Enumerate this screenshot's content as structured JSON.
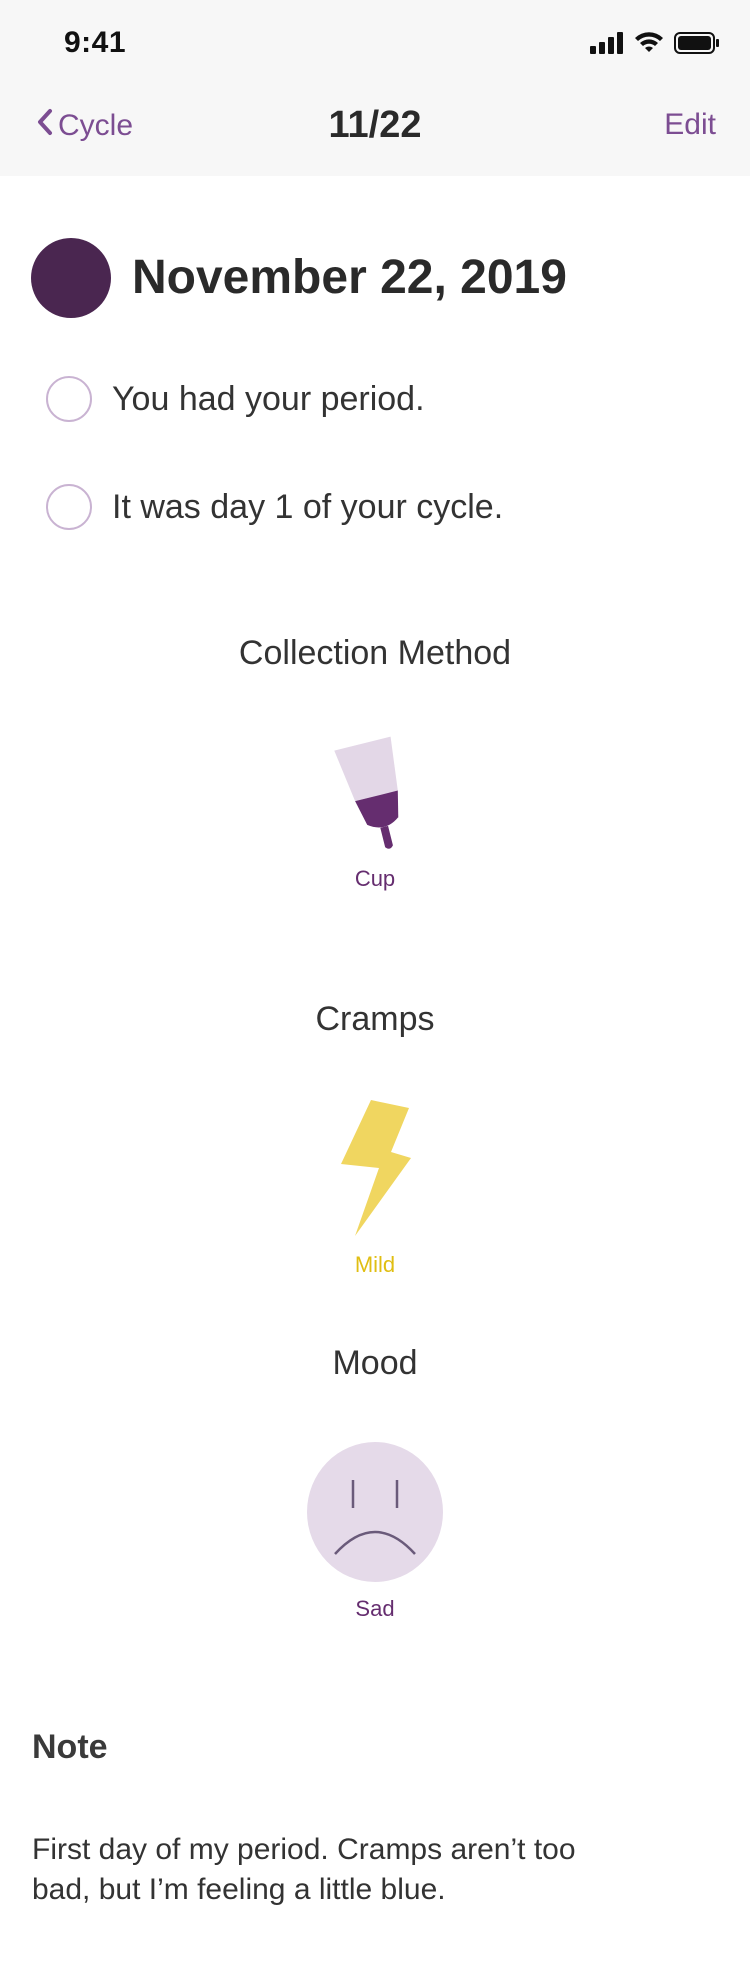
{
  "status_bar": {
    "time": "9:41",
    "icons": [
      "signal-icon",
      "wifi-icon",
      "battery-icon"
    ]
  },
  "nav": {
    "back_label": "Cycle",
    "title": "11/22",
    "edit_label": "Edit"
  },
  "day": {
    "date": "November 22, 2019",
    "statuses": [
      "You had your period.",
      "It was day 1 of your cycle."
    ]
  },
  "collection_method": {
    "heading": "Collection Method",
    "value": "Cup",
    "icon": "menstrual-cup-icon"
  },
  "cramps": {
    "heading": "Cramps",
    "value": "Mild",
    "icon": "lightning-icon"
  },
  "mood": {
    "heading": "Mood",
    "value": "Sad",
    "icon": "sad-face-icon"
  },
  "note": {
    "heading": "Note",
    "body": "First day of my period. Cramps aren’t too bad, but I’m feeling a little blue."
  },
  "colors": {
    "accent": "#7C4D92",
    "date_dot": "#4A2650",
    "cup_dark": "#652D6F",
    "cup_light": "#E3D7E7",
    "cramps": "#F0D660",
    "cramps_label": "#E0BE12",
    "mood_face": "#E5DAE9",
    "mood_label": "#652D6F"
  }
}
